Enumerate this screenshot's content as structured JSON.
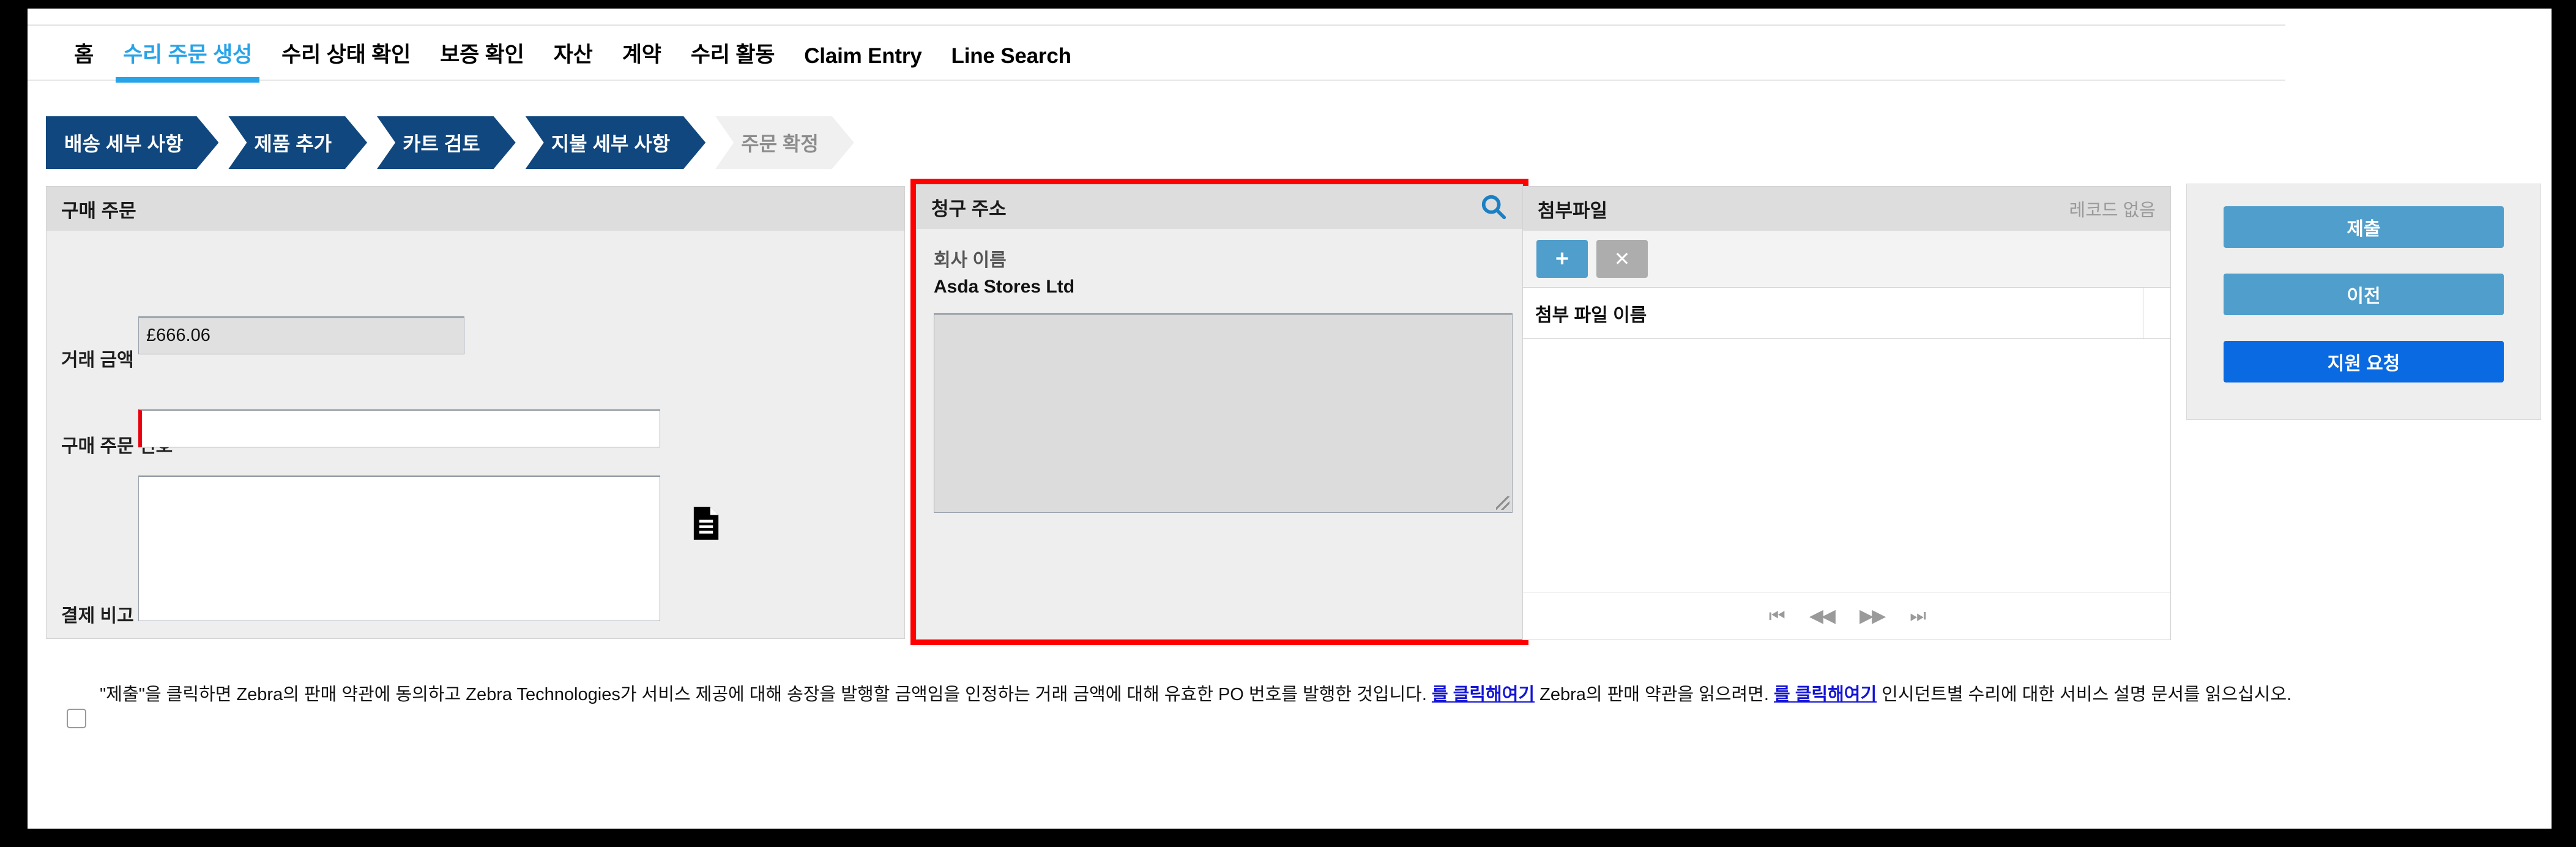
{
  "nav": {
    "tabs": [
      {
        "label": "홈",
        "active": false
      },
      {
        "label": "수리 주문 생성",
        "active": true
      },
      {
        "label": "수리 상태 확인",
        "active": false
      },
      {
        "label": "보증 확인",
        "active": false
      },
      {
        "label": "자산",
        "active": false
      },
      {
        "label": "계약",
        "active": false
      },
      {
        "label": "수리 활동",
        "active": false
      },
      {
        "label": "Claim Entry",
        "active": false
      },
      {
        "label": "Line Search",
        "active": false
      }
    ]
  },
  "steps": [
    {
      "label": "배송 세부 사항",
      "state": "done"
    },
    {
      "label": "제품 추가",
      "state": "done"
    },
    {
      "label": "카트 검토",
      "state": "done"
    },
    {
      "label": "지불 세부 사항",
      "state": "current"
    },
    {
      "label": "주문 확정",
      "state": "pending"
    }
  ],
  "purchase_order": {
    "title": "구매 주문",
    "amount_label": "거래 금액",
    "amount_value": "£666.06",
    "po_number_label": "구매 주문 번호",
    "po_number_value": "",
    "payment_note_label": "결제 비고",
    "payment_note_value": "",
    "invoice_icon": "document-icon"
  },
  "billing_address": {
    "title": "청구 주소",
    "search_icon": "search-icon",
    "company_label": "회사 이름",
    "company_value": "Asda Stores Ltd",
    "address_value": ""
  },
  "attachments": {
    "title": "첨부파일",
    "record_status": "레코드 없음",
    "add_label": "+",
    "delete_label": "✕",
    "column_name": "첨부 파일 이름",
    "rows": [],
    "pager": {
      "first": "⏮",
      "prev": "◀◀",
      "next": "▶▶",
      "last": "⏭"
    }
  },
  "actions": {
    "submit_label": "제출",
    "previous_label": "이전",
    "support_label": "지원 요청"
  },
  "terms": {
    "part1": "\"제출\"을 클릭하면 Zebra의 판매 약관에 동의하고 Zebra Technologies가 서비스 제공에 대해 송장을 발행할 금액임을 인정하는 거래 금액에 대해 유효한 PO 번호를 발행한 것입니다. ",
    "link1": "를 클릭해여기",
    "part2": " Zebra의 판매 약관을 읽으려면. ",
    "link2": "를 클릭해여기",
    "part3": " 인시던트별 수리에 대한 서비스 설명 문서를 읽으십시오.",
    "checked": false
  },
  "colors": {
    "accent_blue": "#27a3e8",
    "step_blue": "#10477e",
    "button_blue": "#4f9ecb",
    "primary_blue": "#0a6ae1",
    "required_red": "#e8000d",
    "highlight_red": "#ff0000",
    "link_blue": "#1414d6"
  }
}
